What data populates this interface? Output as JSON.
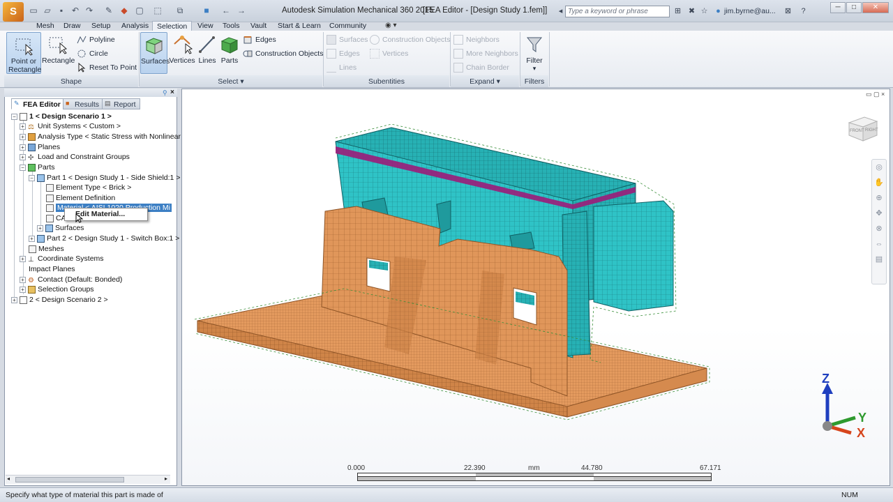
{
  "app": {
    "title": "Autodesk Simulation Mechanical 360 2015",
    "doc_title": "[FEA Editor - [Design Study 1.fem]]",
    "search_placeholder": "Type a keyword or phrase",
    "user": "jim.byrne@au..."
  },
  "menu_tabs": [
    "Mesh",
    "Draw",
    "Setup",
    "Analysis",
    "Selection",
    "View",
    "Tools",
    "Vault",
    "Start & Learn",
    "Community"
  ],
  "ribbon": {
    "shape": {
      "title": "Shape",
      "point_or_rectangle": "Point or Rectangle",
      "rectangle": "Rectangle",
      "polyline": "Polyline",
      "circle": "Circle",
      "reset_to_point": "Reset To Point"
    },
    "select": {
      "title": "Select",
      "surfaces": "Surfaces",
      "vertices": "Vertices",
      "lines": "Lines",
      "parts": "Parts",
      "edges": "Edges",
      "construction_objects": "Construction Objects"
    },
    "subentities": {
      "title": "Subentities",
      "surfaces": "Surfaces",
      "construction_objects": "Construction Objects",
      "edges": "Edges",
      "vertices": "Vertices",
      "lines": "Lines"
    },
    "expand": {
      "title": "Expand",
      "neighbors": "Neighbors",
      "more_neighbors": "More Neighbors",
      "chain_border": "Chain Border"
    },
    "filters": {
      "title": "Filters",
      "filter": "Filter"
    }
  },
  "browser": {
    "tabs": [
      "FEA Editor",
      "Results",
      "Report"
    ],
    "tree": {
      "design_scenario_1": "1 < Design Scenario 1 >",
      "unit_systems": "Unit Systems < Custom >",
      "analysis_type": "Analysis Type < Static Stress with Nonlinear",
      "planes": "Planes",
      "load_groups": "Load and Constraint Groups",
      "parts": "Parts",
      "part1": "Part 1 < Design Study 1 - Side Shield:1 >",
      "element_type": "Element Type < Brick >",
      "element_definition": "Element Definition",
      "material": "Material < AISI 1020 Production Mi",
      "cad": "CAD",
      "surfaces": "Surfaces",
      "part2": "Part 2 < Design Study 1 - Switch Box:1 >",
      "meshes": "Meshes",
      "coordinate_systems": "Coordinate Systems",
      "impact_planes": "Impact Planes",
      "contact": "Contact (Default: Bonded)",
      "selection_groups": "Selection Groups",
      "design_scenario_2": "2 < Design Scenario 2 >"
    }
  },
  "context_menu": {
    "edit_material": "Edit Material..."
  },
  "viewport": {
    "viewcube_front": "FRONT",
    "viewcube_right": "RIGHT",
    "triad": {
      "z": "Z",
      "y": "Y",
      "x": "X"
    },
    "scale": {
      "t0": "0.000",
      "t1": "22.390",
      "unit": "mm",
      "t2": "44.780",
      "t3": "67.171"
    }
  },
  "status": {
    "message": "Specify what type of material this part is made of",
    "num": "NUM"
  },
  "colors": {
    "accent": "#3c7fc4",
    "mesh_teal": "#2fc3c6",
    "mesh_orange": "#e0965a",
    "constraint_green": "#3a8f3a",
    "load_magenta": "#9c1c79"
  }
}
